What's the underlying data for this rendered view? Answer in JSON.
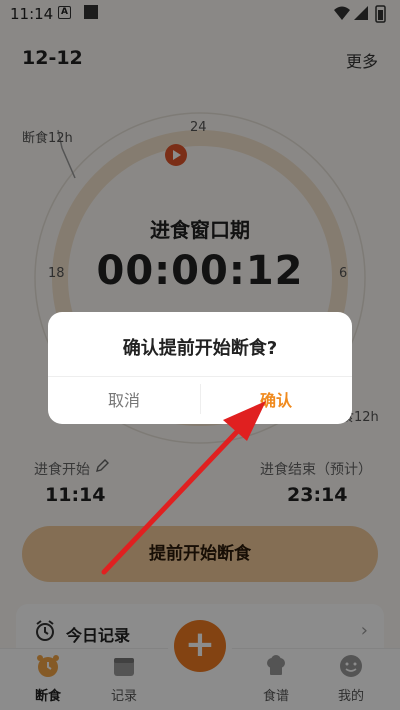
{
  "status_bar": {
    "time": "11:14",
    "a_badge": "A"
  },
  "header": {
    "date": "12-12",
    "more_label": "更多"
  },
  "dial": {
    "fasting_label": "断食12h",
    "eating_label": "进食12h",
    "tick_top": "24",
    "tick_left": "18",
    "tick_right": "6",
    "title": "进食窗口期",
    "timer": "00:00:12"
  },
  "info": {
    "start_label": "进食开始",
    "start_time": "11:14",
    "end_label": "进食结束（预计）",
    "end_time": "23:14"
  },
  "main_button_label": "提前开始断食",
  "record": {
    "title": "今日记录"
  },
  "tabs": [
    {
      "label": "断食",
      "icon": "alarm-clock-icon"
    },
    {
      "label": "记录",
      "icon": "calendar-icon"
    },
    {
      "label": "食谱",
      "icon": "chef-hat-icon"
    },
    {
      "label": "我的",
      "icon": "smiley-icon"
    }
  ],
  "fab_label": "+",
  "dialog": {
    "title": "确认提前开始断食?",
    "cancel_label": "取消",
    "confirm_label": "确认"
  },
  "colors": {
    "accent": "#ee7a22",
    "confirm": "#f08a1e",
    "button_bg": "#f0c89a",
    "arrow": "#e02020"
  }
}
